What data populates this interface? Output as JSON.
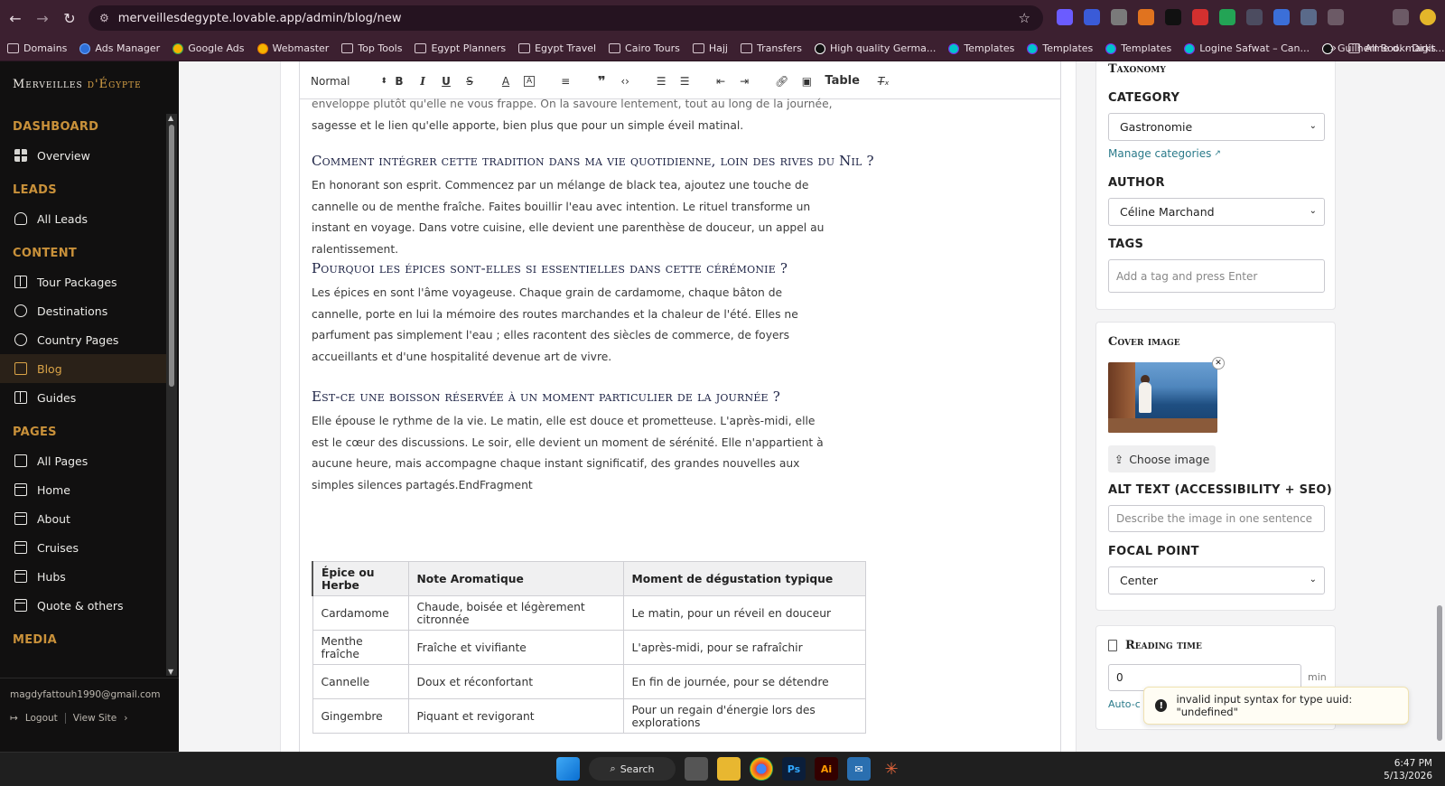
{
  "browser": {
    "url": "merveillesdegypte.lovable.app/admin/blog/new",
    "bookmarks": [
      "Domains",
      "Ads Manager",
      "Google Ads",
      "Webmaster",
      "Top Tools",
      "Egypt Planners",
      "Egypt Travel",
      "Cairo Tours",
      "Hajj",
      "Transfers",
      "High quality Germa...",
      "Templates",
      "Templates",
      "Templates",
      "Logine Safwat – Can...",
      "Guilherme d. - Digit..."
    ],
    "all_bookmarks": "All Bookmarks"
  },
  "sidebar": {
    "brand_main": "Merveilles",
    "brand_accent": "d'Égypte",
    "sections": {
      "dashboard": "DASHBOARD",
      "leads": "LEADS",
      "content": "CONTENT",
      "pages": "PAGES",
      "media": "MEDIA"
    },
    "items": {
      "overview": "Overview",
      "all_leads": "All Leads",
      "tour_packages": "Tour Packages",
      "destinations": "Destinations",
      "country_pages": "Country Pages",
      "blog": "Blog",
      "guides": "Guides",
      "all_pages": "All Pages",
      "home": "Home",
      "about": "About",
      "cruises": "Cruises",
      "hubs": "Hubs",
      "quote_others": "Quote & others"
    },
    "email": "magdyfattouh1990@gmail.com",
    "logout": "Logout",
    "view_site": "View Site"
  },
  "toolbar": {
    "format": "Normal",
    "table": "Table"
  },
  "article": {
    "p0_line1": "enveloppe plutôt qu'elle ne vous frappe. On la savoure lentement, tout au long de la journée, pour la",
    "p0_line2": "sagesse et le lien qu'elle apporte, bien plus que pour un simple éveil matinal.",
    "h1": "Comment intégrer cette tradition dans ma vie quotidienne, loin des rives du Nil ?",
    "p1": "En honorant son esprit. Commencez par un mélange de black tea, ajoutez une touche de cannelle ou de menthe fraîche. Faites bouillir l'eau avec intention. Le rituel transforme un instant en voyage. Dans votre cuisine, elle devient une parenthèse de douceur, un appel au ralentissement.",
    "h2": "Pourquoi les épices sont-elles si essentielles dans cette cérémonie ?",
    "p2": "Les épices en sont l'âme voyageuse. Chaque grain de cardamome, chaque bâton de cannelle, porte en lui la mémoire des routes marchandes et la chaleur de l'été. Elles ne parfument pas simplement l'eau ; elles racontent des siècles de commerce, de foyers accueillants et d'une hospitalité devenue art de vivre.",
    "h3": "Est-ce une boisson réservée à un moment particulier de la journée ?",
    "p3": "Elle épouse le rythme de la vie. Le matin, elle est douce et prometteuse. L'après-midi, elle est le cœur des discussions. Le soir, elle devient un moment de sérénité. Elle n'appartient à aucune heure, mais accompagne chaque instant significatif, des grandes nouvelles aux simples silences partagés.EndFragment",
    "table": {
      "headers": [
        "Épice ou Herbe",
        "Note Aromatique",
        "Moment de dégustation typique"
      ],
      "rows": [
        [
          "Cardamome",
          "Chaude, boisée et légèrement citronnée",
          "Le matin, pour un réveil en douceur"
        ],
        [
          "Menthe fraîche",
          "Fraîche et vivifiante",
          "L'après-midi, pour se rafraîchir"
        ],
        [
          "Cannelle",
          "Doux et réconfortant",
          "En fin de journée, pour se détendre"
        ],
        [
          "Gingembre",
          "Piquant et revigorant",
          "Pour un regain d'énergie lors des explorations"
        ]
      ]
    }
  },
  "panel": {
    "taxonomy_title": "Taxonomy",
    "category_label": "CATEGORY",
    "category_value": "Gastronomie",
    "manage_categories": "Manage categories",
    "author_label": "AUTHOR",
    "author_value": "Céline Marchand",
    "tags_label": "TAGS",
    "tags_placeholder": "Add a tag and press Enter",
    "cover_title": "Cover image",
    "choose_image": "Choose image",
    "alt_label": "ALT TEXT (ACCESSIBILITY + SEO)",
    "alt_placeholder": "Describe the image in one sentence",
    "focal_label": "FOCAL POINT",
    "focal_value": "Center",
    "reading_title": "Reading time",
    "reading_value": "0",
    "reading_unit": "min",
    "auto_calc": "Auto-c"
  },
  "toast": {
    "message": "invalid input syntax for type uuid: \"undefined\""
  },
  "taskbar": {
    "search": "Search",
    "time": "6:47 PM",
    "date": "5/13/2026"
  }
}
